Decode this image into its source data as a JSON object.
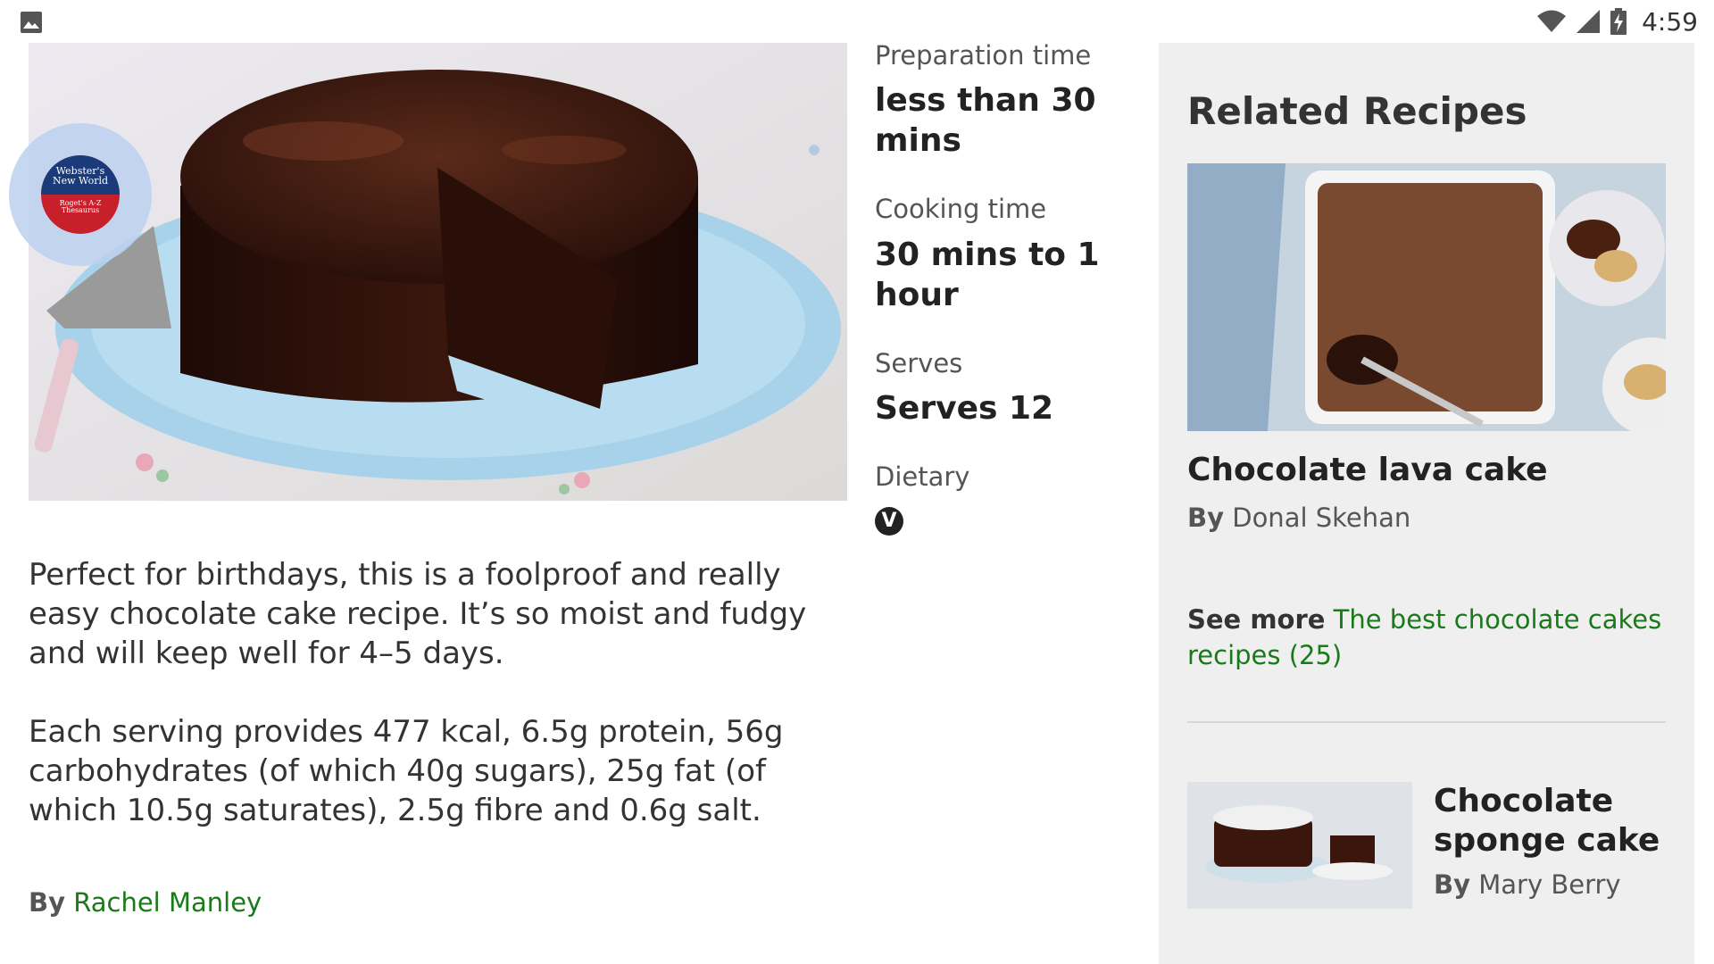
{
  "status_bar": {
    "time": "4:59",
    "icons": [
      "image-icon",
      "wifi-icon",
      "signal-icon",
      "battery-charging-icon"
    ]
  },
  "hero": {
    "image": "chocolate-cake-photo",
    "overlay_badge": {
      "icon": "thesaurus-app-icon",
      "logo_line1": "Webster's",
      "logo_line2": "New World",
      "logo_line3": "Roget's A-Z",
      "logo_line4": "Thesaurus"
    }
  },
  "meta": {
    "prep_label": "Preparation time",
    "prep_value": "less than 30 mins",
    "cook_label": "Cooking time",
    "cook_value": "30 mins to 1 hour",
    "serves_label": "Serves",
    "serves_value": "Serves 12",
    "dietary_label": "Dietary",
    "dietary_badge": "V"
  },
  "description": {
    "intro": "Perfect for birthdays, this is a foolproof and really easy chocolate cake recipe. It’s so moist and fudgy and will keep well for 4–5 days.",
    "nutrition": "Each serving provides 477 kcal, 6.5g protein, 56g carbohydrates (of which 40g sugars), 25g fat (of which 10.5g saturates), 2.5g fibre and 0.6g salt."
  },
  "author": {
    "by_label": "By",
    "name": "Rachel Manley"
  },
  "related": {
    "title": "Related Recipes",
    "card1": {
      "title": "Chocolate lava cake",
      "by_label": "By",
      "author": "Donal Skehan"
    },
    "see_more": {
      "label": "See more",
      "link": "The best chocolate cakes recipes (25)"
    },
    "card2": {
      "title": "Chocolate sponge cake",
      "by_label": "By",
      "author": "Mary Berry"
    }
  },
  "colors": {
    "link_green": "#1a7a1a",
    "panel_bg": "#efefef",
    "text_dark": "#222222"
  }
}
